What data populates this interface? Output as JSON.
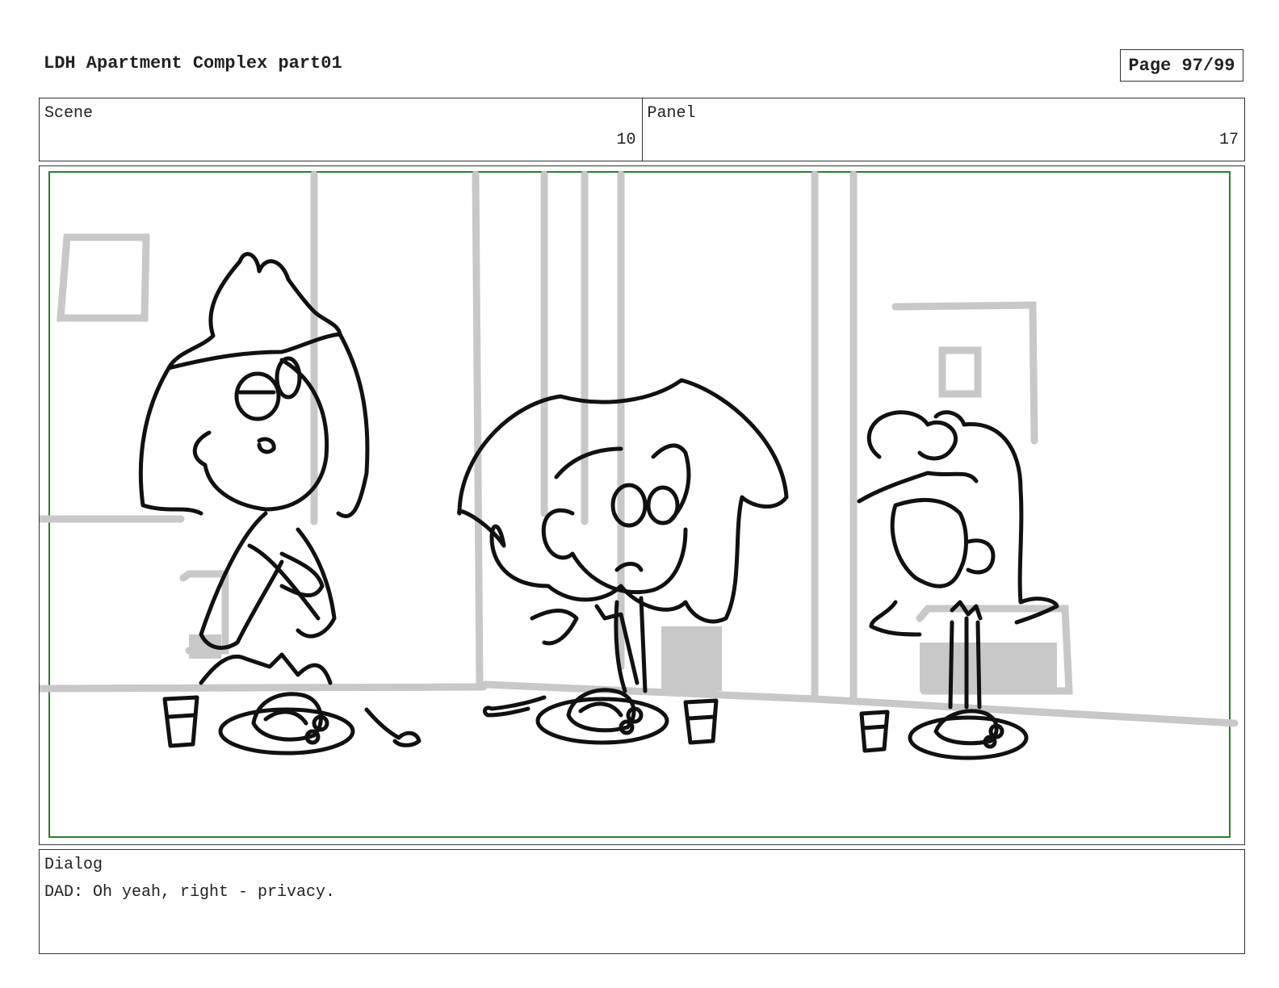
{
  "header": {
    "title": "LDH Apartment Complex part01",
    "page": "Page 97/99"
  },
  "scene": {
    "label": "Scene",
    "value": "10"
  },
  "panel": {
    "label": "Panel",
    "value": "17"
  },
  "dialog": {
    "label": "Dialog",
    "text": "DAD: Oh yeah, right - privacy."
  },
  "colors": {
    "border": "#333333",
    "frame_green": "#2e7d32",
    "background_lines": "#c8c8c8",
    "ink": "#111111"
  }
}
